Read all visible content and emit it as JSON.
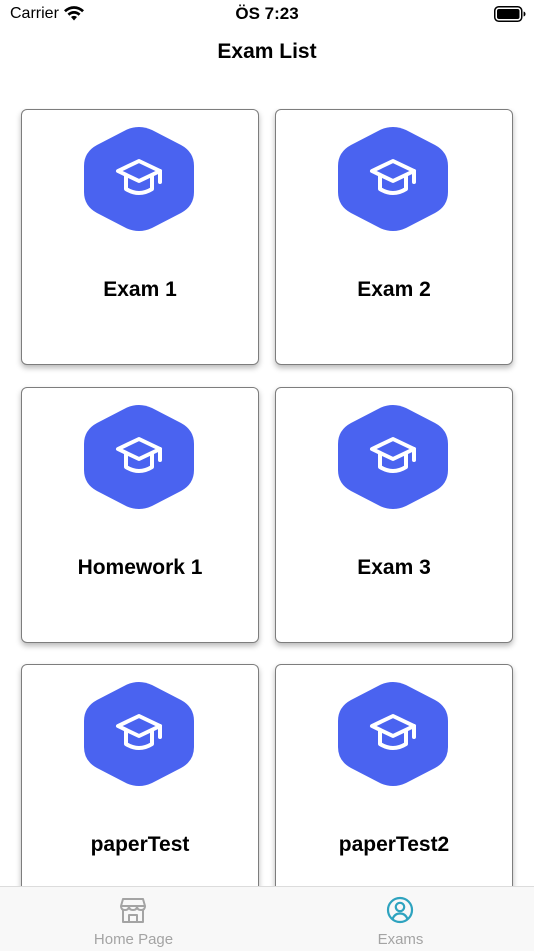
{
  "status_bar": {
    "carrier": "Carrier",
    "time": "ÖS 7:23"
  },
  "header": {
    "title": "Exam List"
  },
  "exams": [
    {
      "label": "Exam 1",
      "icon": "graduation-cap-icon"
    },
    {
      "label": "Exam 2",
      "icon": "graduation-cap-icon"
    },
    {
      "label": "Homework 1",
      "icon": "graduation-cap-icon"
    },
    {
      "label": "Exam 3",
      "icon": "graduation-cap-icon"
    },
    {
      "label": "paperTest",
      "icon": "graduation-cap-icon"
    },
    {
      "label": "paperTest2",
      "icon": "graduation-cap-icon"
    }
  ],
  "tab_bar": {
    "items": [
      {
        "label": "Home Page",
        "icon": "storefront-icon",
        "selected": false
      },
      {
        "label": "Exams",
        "icon": "user-circle-icon",
        "selected": true
      }
    ]
  },
  "colors": {
    "hexagon": "#4a63f0",
    "tab_active": "#2ea3bf",
    "tab_inactive": "#a4a4a4"
  }
}
